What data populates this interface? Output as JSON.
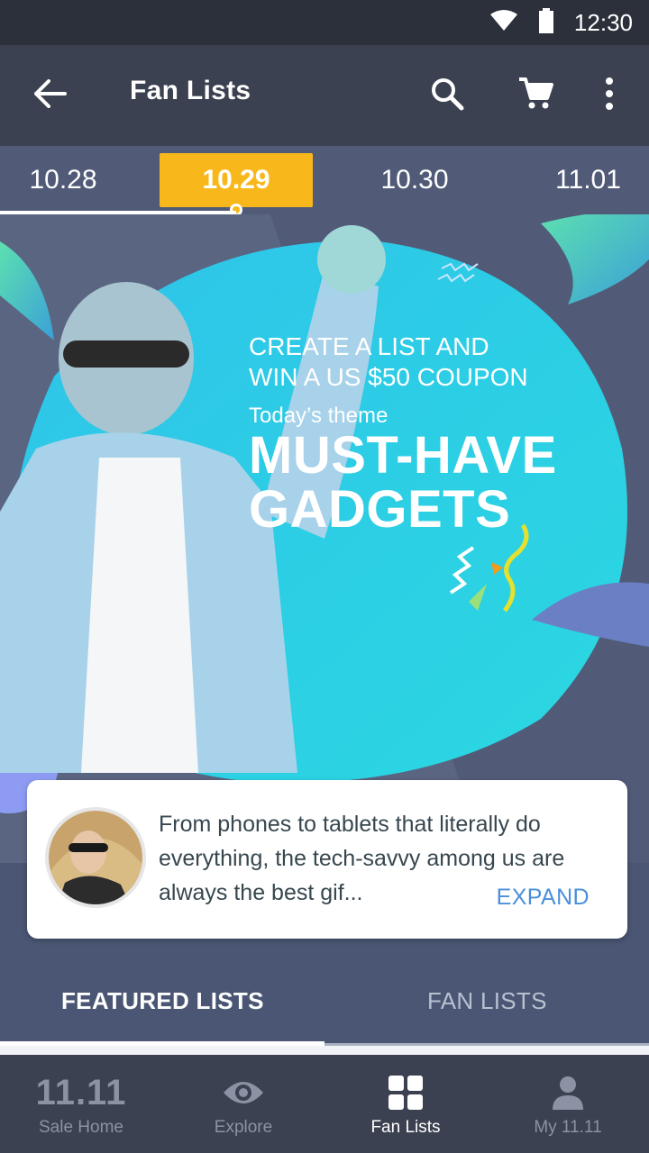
{
  "status_bar": {
    "time": "12:30"
  },
  "app_bar": {
    "title": "Fan Lists",
    "icons": [
      "back-arrow-icon",
      "search-icon",
      "cart-icon",
      "more-vert-icon"
    ]
  },
  "date_tabs": [
    {
      "label": "10.28",
      "active": false
    },
    {
      "label": "10.29",
      "active": true
    },
    {
      "label": "10.30",
      "active": false
    },
    {
      "label": "11.01",
      "active": false
    }
  ],
  "banner": {
    "cta_line1": "CREATE A LIST AND",
    "cta_line2": "WIN A US $50 COUPON",
    "theme_label": "Today’s theme",
    "theme_line1": "MUST-HAVE",
    "theme_line2": "GADGETS"
  },
  "description": {
    "text": "From phones to tablets that literally do everything, the tech-savvy among us are always the best gif...",
    "expand_label": "EXPAND"
  },
  "list_tabs": {
    "featured": "FEATURED LISTS",
    "fan": "FAN LISTS"
  },
  "bottom_nav": {
    "sale_home_brand": "11.11",
    "sale_home": "Sale Home",
    "explore": "Explore",
    "fan_lists": "Fan Lists",
    "my": "My 11.11"
  },
  "colors": {
    "accent": "#f8b81c",
    "app_bar": "#3b4150",
    "status_bar": "#2b303b",
    "tab_strip": "#515b78",
    "link": "#4a90d9",
    "banner_blob": "#2ad0e6"
  }
}
